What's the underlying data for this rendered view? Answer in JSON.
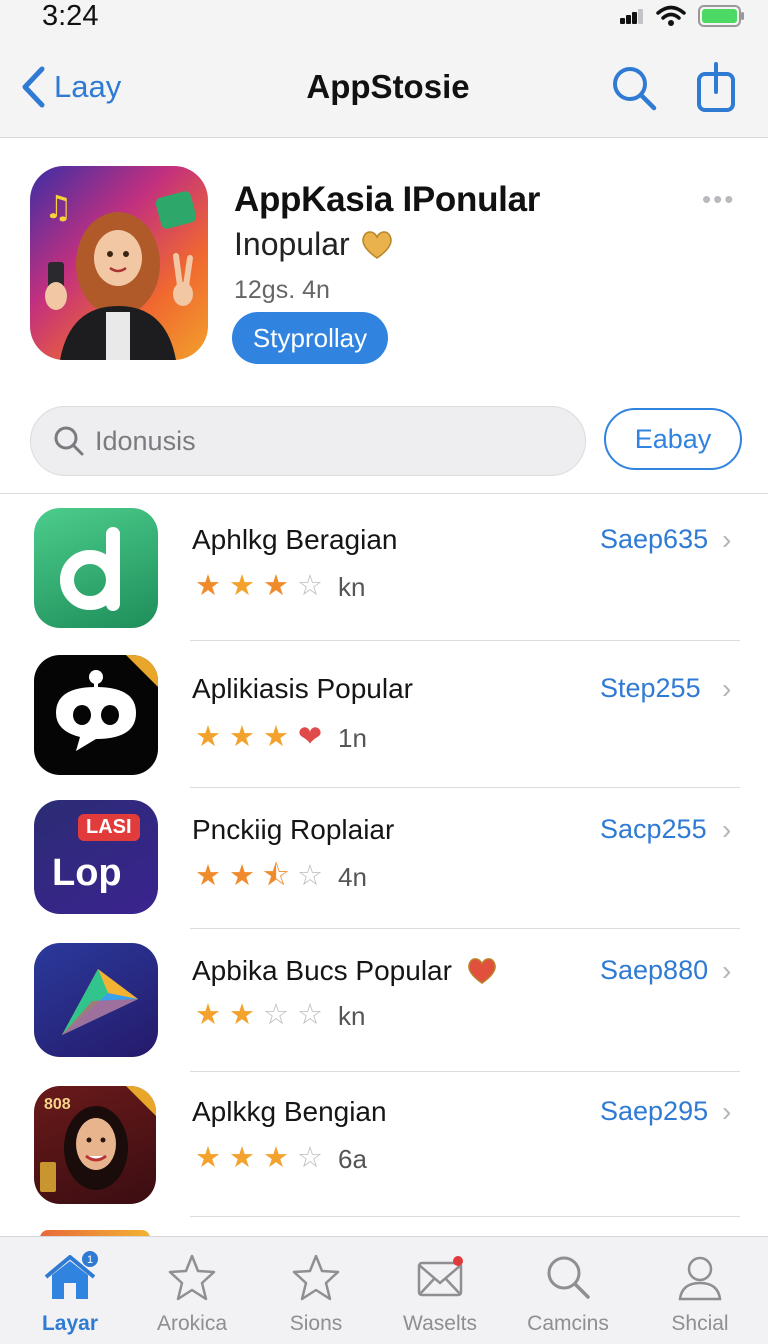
{
  "status": {
    "time": "3:24"
  },
  "nav": {
    "back_label": "Laay",
    "title": "AppStosie"
  },
  "featured": {
    "title": "AppKasia IPonular",
    "subtitle": "Inopular",
    "meta": "12gs. 4n",
    "button_label": "Styprollay"
  },
  "search": {
    "placeholder": "Idonusis",
    "button_label": "Eabay"
  },
  "apps": [
    {
      "name": "Aphlkg Beragian",
      "rating": 3,
      "count": "kn",
      "price": "Saep635"
    },
    {
      "name": "Aplikiasis Popular",
      "rating": 3,
      "count": "1n",
      "price": "Step255",
      "badge": "❤"
    },
    {
      "name": "Pnckiig Roplaiar",
      "rating": 2.5,
      "count": "4n",
      "price": "Sacp255",
      "icon_text": "LASI",
      "icon_text2": "Lop"
    },
    {
      "name": "Apbika Bucs Popular",
      "rating": 2,
      "count": "kn",
      "price": "Saep880"
    },
    {
      "name": "Aplkkg Bengian",
      "rating": 3,
      "count": "6a",
      "price": "Saep295",
      "icon_text": "808"
    }
  ],
  "tabs": [
    {
      "label": "Layar",
      "icon": "home-icon",
      "active": true,
      "badge": "1"
    },
    {
      "label": "Arokica",
      "icon": "star-icon"
    },
    {
      "label": "Sions",
      "icon": "star-icon"
    },
    {
      "label": "Waselts",
      "icon": "mail-icon",
      "dot": true
    },
    {
      "label": "Camcins",
      "icon": "search-icon"
    },
    {
      "label": "Shcial",
      "icon": "person-icon"
    }
  ],
  "colors": {
    "accent": "#3183e0",
    "star": "#f3a32d",
    "background": "#ffffff",
    "bar": "#f4f4f5"
  }
}
